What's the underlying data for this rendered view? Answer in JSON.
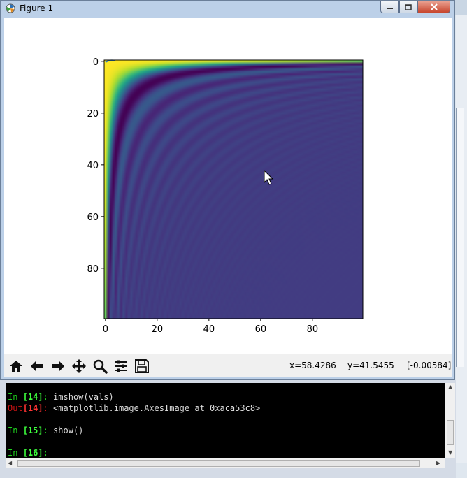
{
  "window": {
    "title": "Figure 1"
  },
  "toolbar": {
    "buttons": [
      "home-icon",
      "back-arrow-icon",
      "forward-arrow-icon",
      "pan-move-icon",
      "zoom-magnifier-icon",
      "subplots-config-icon",
      "save-floppy-icon"
    ],
    "x_readout": "x=58.4286",
    "y_readout": "y=41.5455",
    "value_readout": "[-0.00584]"
  },
  "chart_data": {
    "type": "heatmap",
    "colormap": "viridis",
    "x_ticks": [
      "0",
      "20",
      "40",
      "60",
      "80"
    ],
    "y_ticks": [
      "0",
      "20",
      "40",
      "60",
      "80"
    ],
    "xlim": [
      -0.5,
      99.5
    ],
    "ylim": [
      99.5,
      -0.5
    ],
    "shape": [
      100,
      100
    ]
  },
  "console": {
    "lines": [
      {
        "prompt": "In ",
        "num": "[14]",
        "colon": ":",
        "code": " imshow(vals)",
        "kind": "in"
      },
      {
        "prompt": "Out",
        "num": "[14]",
        "colon": ":",
        "code": " <matplotlib.image.AxesImage at 0xaca53c8>",
        "kind": "out"
      },
      {
        "prompt": "In ",
        "num": "[15]",
        "colon": ":",
        "code": " show()",
        "kind": "in"
      },
      {
        "prompt": "In ",
        "num": "[16]",
        "colon": ":",
        "code": "",
        "kind": "in"
      }
    ]
  }
}
